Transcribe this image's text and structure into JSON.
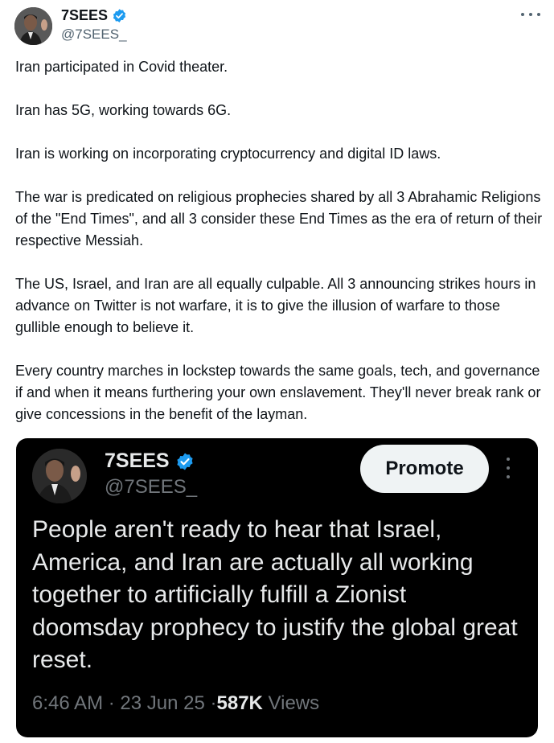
{
  "author": {
    "display_name": "7SEES",
    "handle": "@7SEES_",
    "verified": true
  },
  "more_icon": "more-horizontal-icon",
  "paragraphs": [
    "Iran participated in Covid theater.",
    "Iran has 5G, working towards 6G.",
    "Iran is working on incorporating cryptocurrency and digital ID laws.",
    "The war is predicated on religious prophecies shared by all 3 Abrahamic Religions of the \"End Times\", and all 3 consider these End Times as the era of return of their respective Messiah.",
    "The US, Israel, and Iran are all equally culpable. All 3 announcing strikes hours in advance on Twitter is not warfare, it is to give the illusion of warfare to those gullible enough to believe it.",
    "Every country marches in lockstep towards the same goals, tech, and governance if and when it means furthering your own enslavement. They'll never break rank or give concessions in the benefit of the layman."
  ],
  "quoted": {
    "display_name": "7SEES",
    "handle": "@7SEES_",
    "verified": true,
    "promote_label": "Promote",
    "text": "People aren't ready to hear that Israel, America, and Iran are actually all working together to artificially fulfill a Zionist doomsday prophecy to justify the global great reset.",
    "time": "6:46 AM",
    "separator": "·",
    "date": "23 Jun 25",
    "views_count": "587K",
    "views_label": "Views"
  },
  "colors": {
    "verified_blue": "#1d9bf0",
    "text_primary": "#0f1419",
    "text_secondary": "#536471",
    "card_bg": "#000000"
  }
}
